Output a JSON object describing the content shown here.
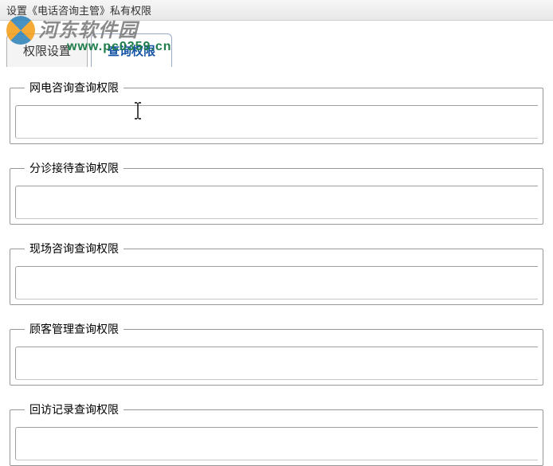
{
  "window": {
    "title": "设置《电话咨询主管》私有权限"
  },
  "watermark": {
    "text": "河东软件园",
    "url": "www.pc0359.cn"
  },
  "tabs": {
    "items": [
      {
        "label": "权限设置",
        "active": false
      },
      {
        "label": "查询权限",
        "active": true
      }
    ]
  },
  "groups": [
    {
      "legend": "网电咨询查询权限",
      "value": ""
    },
    {
      "legend": "分诊接待查询权限",
      "value": ""
    },
    {
      "legend": "现场咨询查询权限",
      "value": ""
    },
    {
      "legend": "顾客管理查询权限",
      "value": ""
    },
    {
      "legend": "回访记录查询权限",
      "value": ""
    }
  ]
}
